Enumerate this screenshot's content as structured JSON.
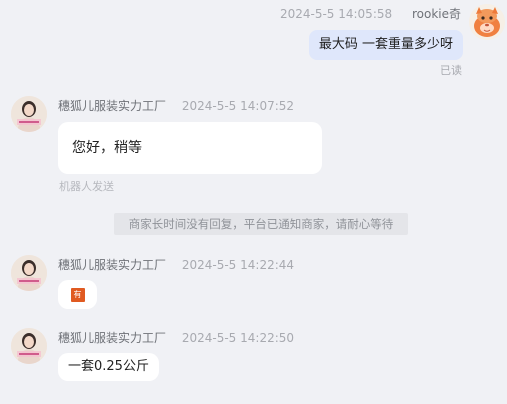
{
  "self": {
    "timestamp": "2024-5-5 14:05:58",
    "name": "rookie奇",
    "message": "最大码  一套重量多少呀",
    "status": "已读"
  },
  "messages": [
    {
      "sender": "穗狐儿服装实力工厂",
      "timestamp": "2024-5-5 14:07:52",
      "text": "您好，稍等",
      "note": "机器人发送"
    },
    {
      "sender": "穗狐儿服装实力工厂",
      "timestamp": "2024-5-5 14:22:44",
      "image_glyph": "有"
    },
    {
      "sender": "穗狐儿服装实力工厂",
      "timestamp": "2024-5-5 14:22:50",
      "text": "一套0.25公斤"
    }
  ],
  "system_notice": "商家长时间没有回复，平台已通知商家，请耐心等待",
  "colors": {
    "background": "#f0f1f5",
    "self_bubble": "#dfe7fb",
    "other_bubble": "#ffffff",
    "image_icon": "#e05a21"
  },
  "icons": {
    "self_avatar": "orange-cartoon-avatar-icon",
    "shop_avatar": "shop-photo-avatar-icon"
  }
}
